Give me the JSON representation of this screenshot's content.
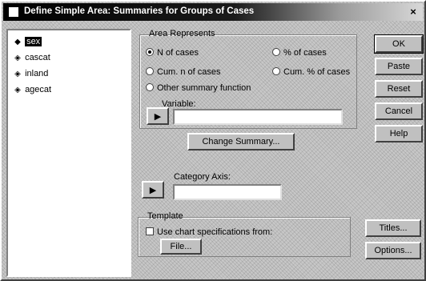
{
  "window": {
    "title": "Define Simple Area: Summaries for Groups of Cases",
    "close": "×"
  },
  "tree": {
    "items": [
      {
        "label": "sex",
        "selected": true
      },
      {
        "label": "cascat",
        "selected": false
      },
      {
        "label": "inland",
        "selected": false
      },
      {
        "label": "agecat",
        "selected": false
      }
    ]
  },
  "area_represents": {
    "title": "Area Represents",
    "options": [
      {
        "label": "N of cases",
        "selected": true
      },
      {
        "label": "% of cases",
        "selected": false
      },
      {
        "label": "Cum. n of cases",
        "selected": false
      },
      {
        "label": "Cum. % of cases",
        "selected": false
      },
      {
        "label": "Other summary function",
        "selected": false
      }
    ]
  },
  "variable": {
    "label": "Variable:",
    "change_summary": "Change Summary..."
  },
  "category_axis": {
    "label": "Category Axis:",
    "value": ""
  },
  "template": {
    "title": "Template",
    "checkbox_label": "Use chart specifications from:",
    "file_button": "File..."
  },
  "buttons": {
    "ok": "OK",
    "paste": "Paste",
    "reset": "Reset",
    "cancel": "Cancel",
    "help": "Help",
    "titles": "Titles...",
    "options": "Options..."
  },
  "icons": {
    "tree_item": "variable-icon",
    "arrow": "right-arrow-icon"
  }
}
